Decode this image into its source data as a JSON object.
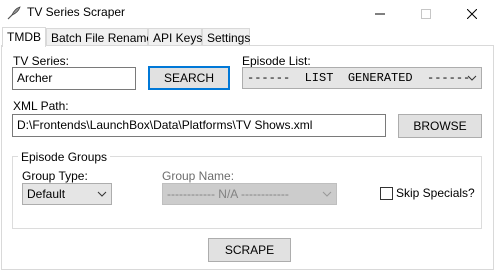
{
  "window": {
    "title": "TV Series Scraper",
    "app_icon": "feather-pen-icon",
    "minimize_icon": "minimize-icon",
    "maximize_icon": "maximize-icon",
    "close_icon": "close-icon"
  },
  "tabs": [
    {
      "label": "TMDB",
      "active": true
    },
    {
      "label": "Batch File Rename",
      "active": false
    },
    {
      "label": "API Keys",
      "active": false
    },
    {
      "label": "Settings",
      "active": false
    }
  ],
  "tmdb": {
    "tv_series_label": "TV Series:",
    "tv_series_value": "Archer",
    "search_button": "SEARCH",
    "episode_list_label": "Episode List:",
    "episode_list_value": "------  LIST  GENERATED  ------",
    "xml_path_label": "XML Path:",
    "xml_path_value": "D:\\Frontends\\LaunchBox\\Data\\Platforms\\TV Shows.xml",
    "browse_button": "BROWSE",
    "episode_groups": {
      "title": "Episode Groups",
      "group_type_label": "Group Type:",
      "group_type_value": "Default",
      "group_name_label": "Group Name:",
      "group_name_value": "------------ N/A ------------",
      "skip_specials_label": "Skip Specials?",
      "skip_specials_checked": false
    },
    "scrape_button": "SCRAPE"
  },
  "colors": {
    "accent": "#0078d7",
    "button_face": "#e1e1e1",
    "disabled_face": "#cccccc"
  }
}
